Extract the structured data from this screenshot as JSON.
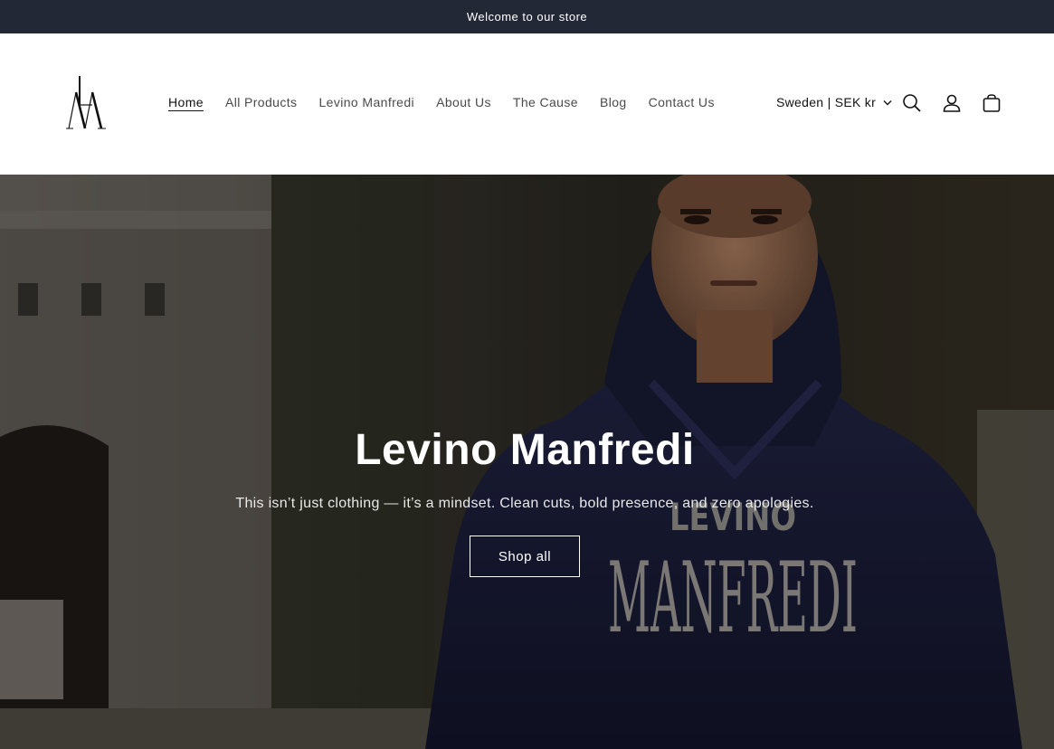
{
  "announcement": {
    "text": "Welcome to our store"
  },
  "header": {
    "logo_letters": "LM",
    "nav": [
      {
        "label": "Home",
        "active": true
      },
      {
        "label": "All Products"
      },
      {
        "label": "Levino Manfredi"
      },
      {
        "label": "About Us"
      },
      {
        "label": "The Cause"
      },
      {
        "label": "Blog"
      },
      {
        "label": "Contact Us"
      }
    ],
    "locale": "Sweden | SEK kr",
    "icons": [
      "search-icon",
      "account-icon",
      "cart-icon",
      "chevron-down-icon"
    ]
  },
  "hero": {
    "title": "Levino Manfredi",
    "subtitle": "This isn’t just clothing — it’s a mindset. Clean cuts, bold presence, and zero apologies.",
    "button": "Shop all",
    "hoodie_print": {
      "line1": "LEVINO",
      "line2": "MANFREDI"
    },
    "hoodie_color": "#1c1f3d"
  }
}
